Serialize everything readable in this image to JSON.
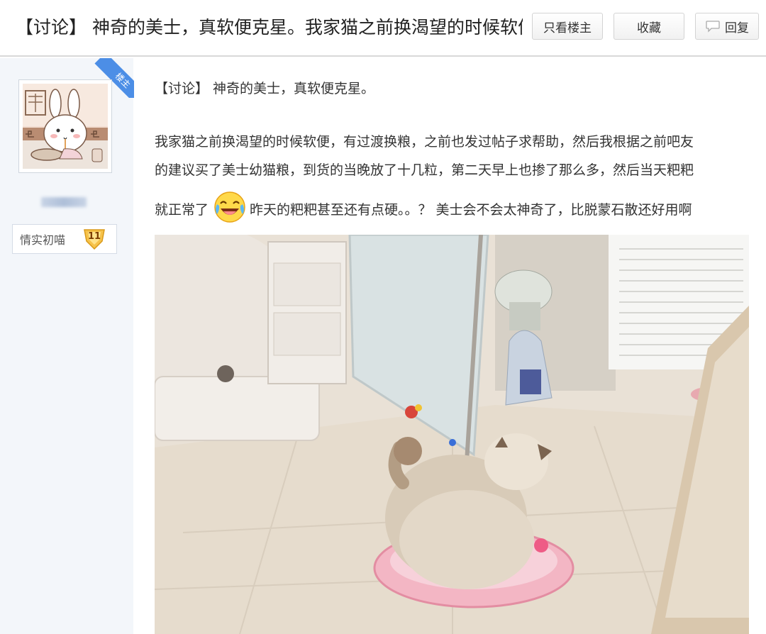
{
  "header": {
    "thread_title": "【讨论】 神奇的美士，真软便克星。我家猫之前换渴望的时候软便",
    "only_op_button": "只看楼主",
    "favorite_button": "收藏",
    "reply_button": "回复"
  },
  "author": {
    "op_badge": "楼主",
    "level_name": "情实初喵",
    "level_number": "11"
  },
  "post": {
    "title": "【讨论】 神奇的美士，真软便克星。",
    "line1": "我家猫之前换渴望的时候软便，有过渡换粮，之前也发过帖子求帮助，然后我根据之前吧友",
    "line2": "的建议买了美士幼猫粮，到货的当晚放了十几粒，第二天早上也掺了那么多，然后当天粑粑",
    "line3_before": "就正常了",
    "line3_after": "昨天的粑粑甚至还有点硬。。？ 美士会不会太神奇了，比脱蒙石散还好用啊",
    "emoji_icon": "laugh-cry-emoji"
  }
}
